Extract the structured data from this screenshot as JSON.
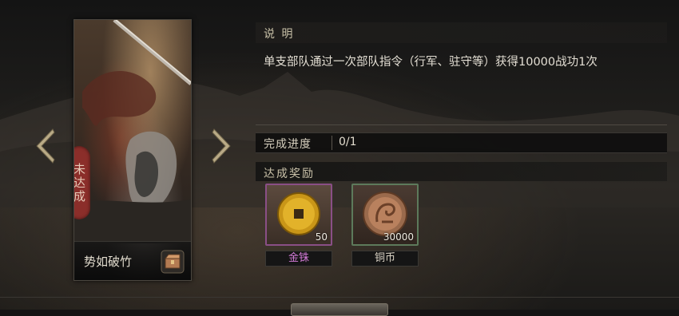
{
  "card": {
    "status_stamp": "未达成",
    "title": "势如破竹"
  },
  "description": {
    "header": "说 明",
    "text": "单支部队通过一次部队指令（行军、驻守等）获得10000战功1次"
  },
  "progress": {
    "label": "完成进度",
    "value": "0/1"
  },
  "rewards": {
    "header": "达成奖励",
    "items": [
      {
        "name": "金铢",
        "quantity": "50",
        "icon": "gold-coin-icon",
        "frame_color": "#8a4f86"
      },
      {
        "name": "铜币",
        "quantity": "30000",
        "icon": "copper-coin-icon",
        "frame_color": "#5d7a5b"
      }
    ]
  },
  "navigation": {
    "prev_icon": "chevron-left-icon",
    "next_icon": "chevron-right-icon"
  }
}
